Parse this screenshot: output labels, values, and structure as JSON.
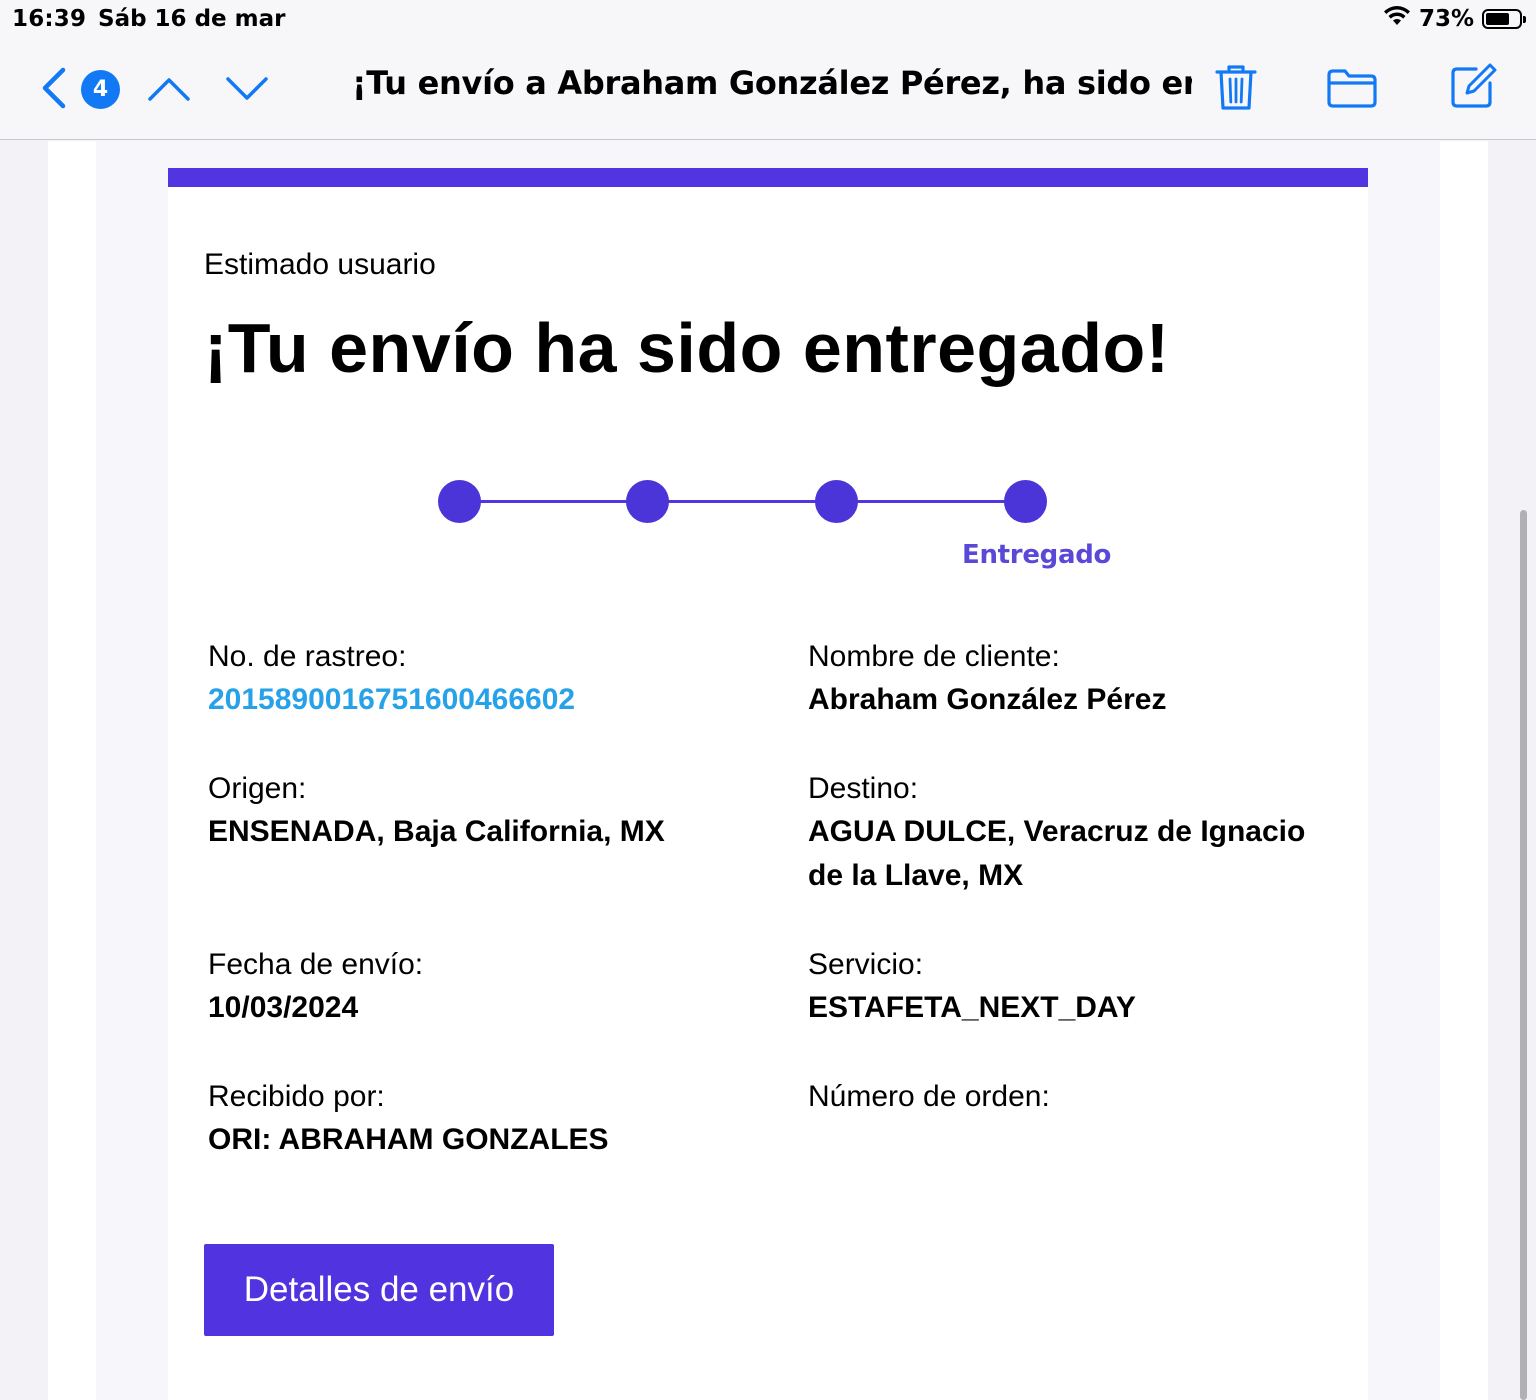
{
  "status_bar": {
    "time": "16:39",
    "date": "Sáb 16 de mar",
    "battery_text": "73%",
    "battery_level": 0.73
  },
  "nav": {
    "unread_count": "4",
    "title": "¡Tu envío a Abraham González Pérez, ha sido entre…",
    "icons": [
      "back-chevron-icon",
      "chevron-up-icon",
      "chevron-down-icon",
      "trash-icon",
      "folder-icon",
      "compose-icon"
    ],
    "accent_color": "#1279f5"
  },
  "email": {
    "greeting": "Estimado usuario",
    "headline": "¡Tu envío ha sido entregado!",
    "progress": {
      "steps_total": 4,
      "current_step": 4,
      "current_label": "Entregado"
    },
    "fields": {
      "tracking": {
        "label": "No. de rastreo:",
        "value": "2015890016751600466602"
      },
      "customer": {
        "label": "Nombre de cliente:",
        "value": "Abraham González Pérez"
      },
      "origin": {
        "label": "Origen:",
        "value": "ENSENADA, Baja California, MX"
      },
      "destination": {
        "label": "Destino:",
        "value_line1": "AGUA DULCE, Veracruz de Ignacio",
        "value_line2": "de la Llave, MX"
      },
      "ship_date": {
        "label": "Fecha de envío:",
        "value": "10/03/2024"
      },
      "service": {
        "label": "Servicio:",
        "value": "ESTAFETA_NEXT_DAY"
      },
      "received_by": {
        "label": "Recibido por:",
        "value": "ORI: ABRAHAM GONZALES"
      },
      "order_number": {
        "label": "Número de orden:",
        "value": ""
      }
    },
    "cta_label": "Detalles de envío",
    "brand_color": "#5235e0",
    "link_color": "#27a2e8"
  }
}
